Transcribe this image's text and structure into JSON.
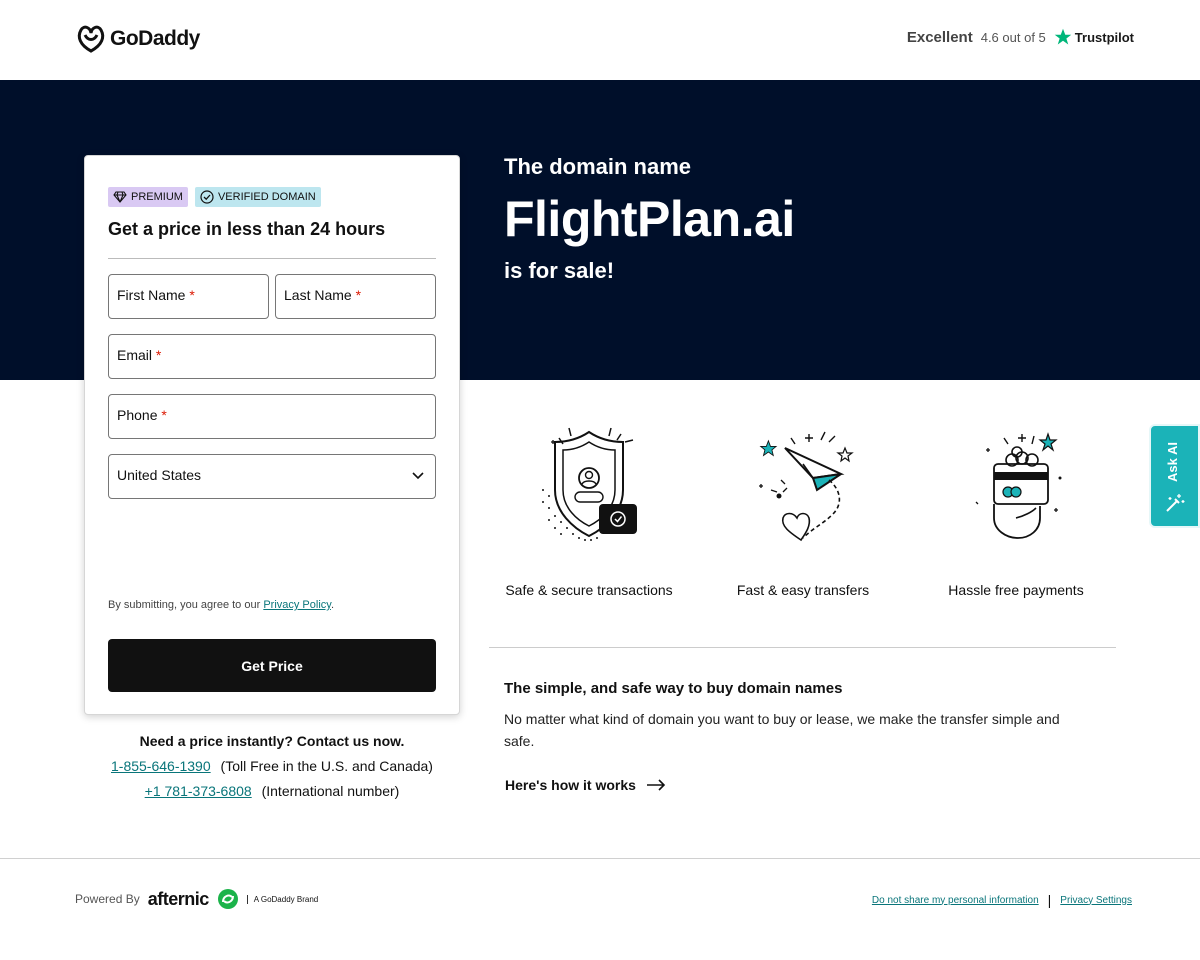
{
  "header": {
    "logo_text": "GoDaddy",
    "rating_word": "Excellent",
    "rating_score": "4.6 out of 5",
    "trustpilot_label": "Trustpilot"
  },
  "hero": {
    "subtitle": "The domain name",
    "domain": "FlightPlan.ai",
    "for_sale": "is for sale!"
  },
  "form": {
    "badge_premium": "PREMIUM",
    "badge_verified": "VERIFIED DOMAIN",
    "title": "Get a price in less than 24 hours",
    "first_name_label": "First Name",
    "last_name_label": "Last Name",
    "email_label": "Email",
    "phone_label": "Phone",
    "required_marker": "*",
    "country_value": "United States",
    "consent_text": "By submitting, you agree to our ",
    "privacy_link": "Privacy Policy",
    "consent_end": ".",
    "submit_label": "Get Price"
  },
  "contact": {
    "title": "Need a price instantly? Contact us now.",
    "tollfree_number": "1-855-646-1390",
    "tollfree_note": "(Toll Free in the U.S. and Canada)",
    "intl_number": "+1 781-373-6808",
    "intl_note": "(International number)"
  },
  "features": [
    {
      "label": "Safe & secure transactions",
      "icon": "shield-lock-icon"
    },
    {
      "label": "Fast & easy transfers",
      "icon": "paper-plane-icon"
    },
    {
      "label": "Hassle free payments",
      "icon": "card-hand-icon"
    }
  ],
  "info": {
    "title": "The simple, and safe way to buy domain names",
    "text": "No matter what kind of domain you want to buy or lease, we make the transfer simple and safe.",
    "link": "Here's how it works"
  },
  "ask_ai": {
    "label": "Ask AI"
  },
  "footer": {
    "powered_by": "Powered By",
    "afternic": "afternic",
    "brand_note": "A GoDaddy Brand",
    "link_do_not_share": "Do not share my personal information",
    "separator": "|",
    "link_privacy_settings": "Privacy Settings"
  },
  "colors": {
    "hero_bg": "#000f2a",
    "teal_link": "#09757a",
    "ask_ai_bg": "#1bb3b8",
    "required": "#db1802",
    "button_bg": "#111111"
  }
}
